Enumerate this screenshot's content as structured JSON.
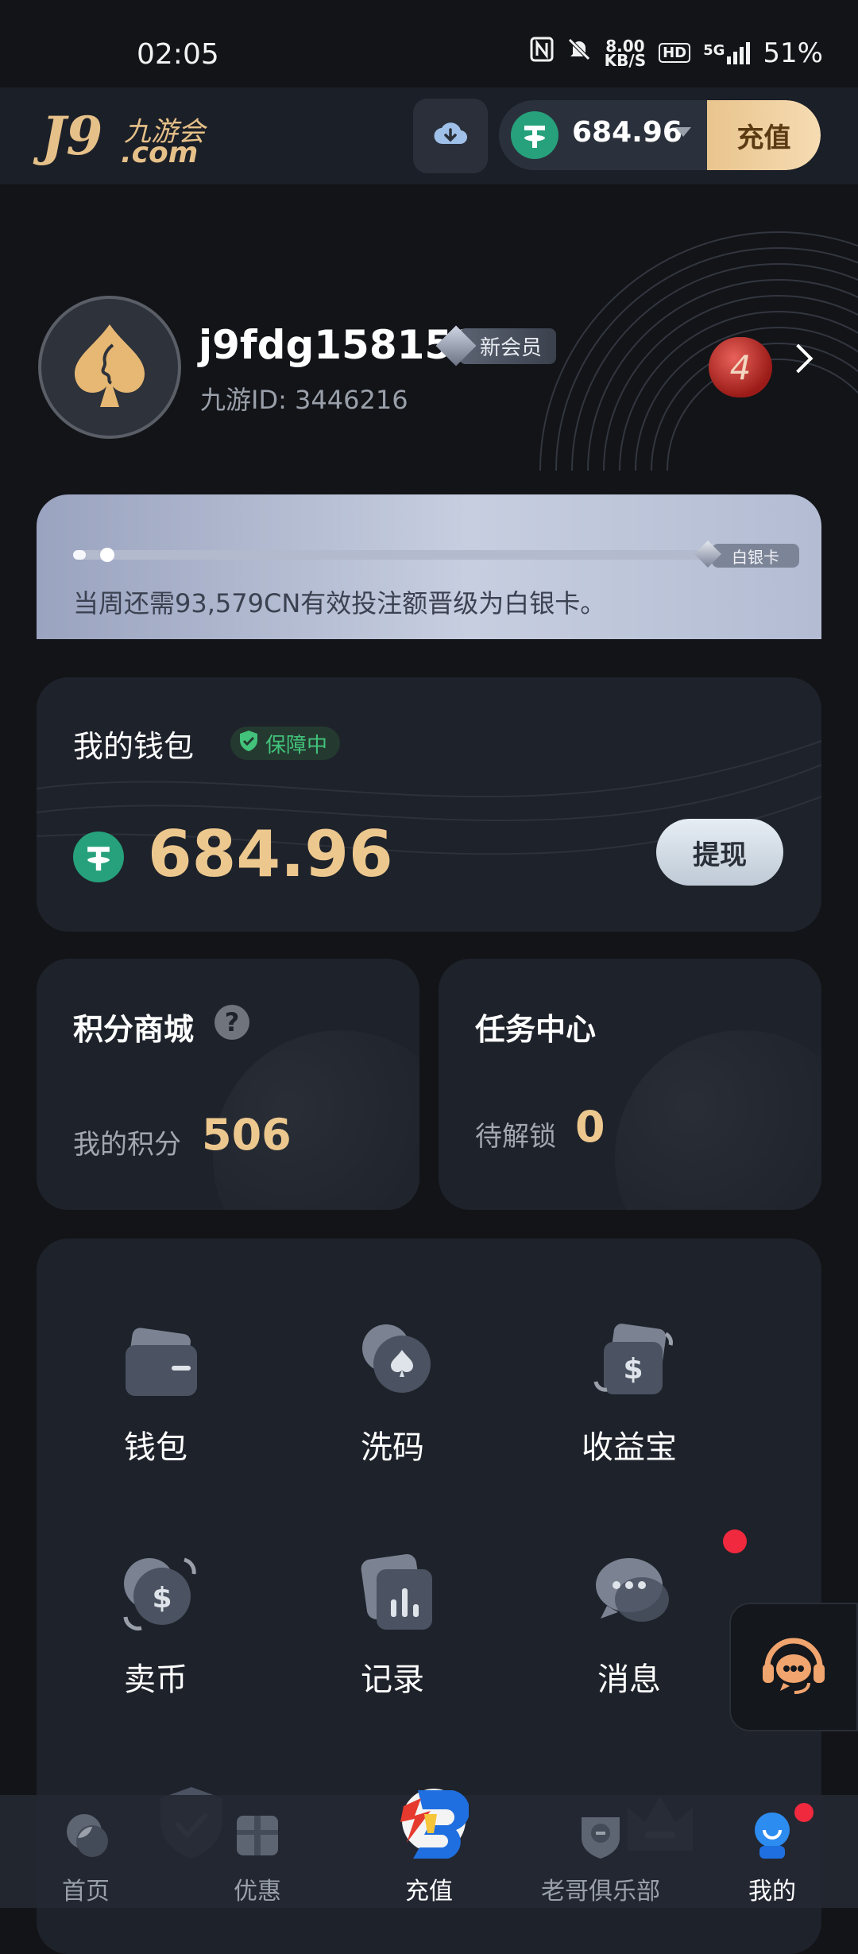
{
  "status_bar": {
    "time": "02:05",
    "net_speed_value": "8.00",
    "net_speed_unit": "KB/S",
    "hd_label": "HD",
    "signal_label": "5G",
    "battery": "51%"
  },
  "header": {
    "logo_main": "J9",
    "logo_cn": "九游会",
    "logo_domain": ".com",
    "balance": "684.96",
    "recharge_label": "充值"
  },
  "profile": {
    "username": "j9fdg158159",
    "member_badge": "新会员",
    "user_id": "九游ID: 3446216",
    "level": "4"
  },
  "vip_progress": {
    "next_level_tag": "白银卡",
    "message": "当周还需93,579CN有效投注额晋级为白银卡。",
    "progress": 0.02
  },
  "wallet": {
    "title": "我的钱包",
    "badge": "保障中",
    "amount": "684.96",
    "withdraw_label": "提现"
  },
  "points": {
    "title": "积分商城",
    "help_icon": "?",
    "label": "我的积分",
    "value": "506"
  },
  "tasks": {
    "title": "任务中心",
    "label": "待解锁",
    "value": "0"
  },
  "grid": [
    {
      "label": "钱包",
      "icon": "wallet-icon"
    },
    {
      "label": "洗码",
      "icon": "spade-coin-icon"
    },
    {
      "label": "收益宝",
      "icon": "dollar-card-icon"
    },
    {
      "label": "卖币",
      "icon": "dollar-exchange-icon"
    },
    {
      "label": "记录",
      "icon": "bar-chart-icon"
    },
    {
      "label": "消息",
      "icon": "chat-bubble-icon"
    }
  ],
  "bottom_nav": [
    {
      "label": "首页",
      "icon": "home-icon"
    },
    {
      "label": "优惠",
      "icon": "gift-icon"
    },
    {
      "label": "充值",
      "icon": "recharge-logo-icon"
    },
    {
      "label": "老哥俱乐部",
      "icon": "club-icon"
    },
    {
      "label": "我的",
      "icon": "profile-icon"
    }
  ],
  "colors": {
    "background": "#121418",
    "card": "#1e222a",
    "gold": "#edc88e",
    "tether_green": "#26a17b",
    "notify_red": "#f0293e",
    "safe_green": "#42c27a"
  }
}
